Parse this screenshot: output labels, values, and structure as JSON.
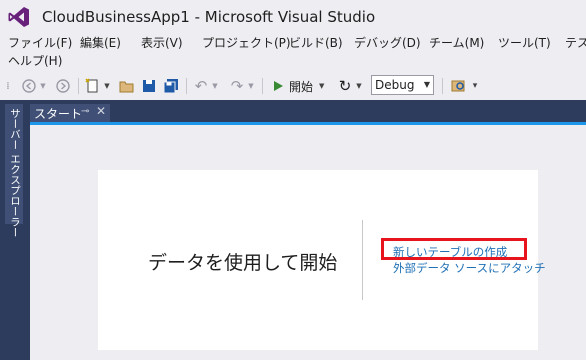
{
  "window": {
    "title": "CloudBusinessApp1 - Microsoft Visual Studio"
  },
  "menu": {
    "items": [
      "ファイル(F)",
      "編集(E)",
      "表示(V)",
      "プロジェクト(P)",
      "ビルド(B)",
      "デバッグ(D)",
      "チーム(M)",
      "ツール(T)",
      "テス",
      "ヘルプ(H)"
    ]
  },
  "toolbar": {
    "start_label": "開始",
    "configuration": "Debug",
    "icons": [
      "back-icon",
      "forward-icon",
      "new-project-icon",
      "open-folder-icon",
      "save-icon",
      "save-all-icon",
      "undo-icon",
      "redo-icon",
      "start-icon",
      "refresh-icon",
      "find-icon"
    ]
  },
  "side_panel": {
    "label": "サーバー エクスプローラー"
  },
  "tabs": [
    {
      "label": "スタート",
      "pin": "⊸",
      "close": "✕"
    }
  ],
  "start_page": {
    "heading": "データを使用して開始",
    "links": [
      "新しいテーブルの作成",
      "外部データ ソースにアタッチ"
    ]
  },
  "colors": {
    "accent": "#1c97ea",
    "vs_purple": "#68217a",
    "highlight": "#e8141d",
    "link": "#1e6fb5",
    "chrome_dark": "#2d3b5c"
  }
}
